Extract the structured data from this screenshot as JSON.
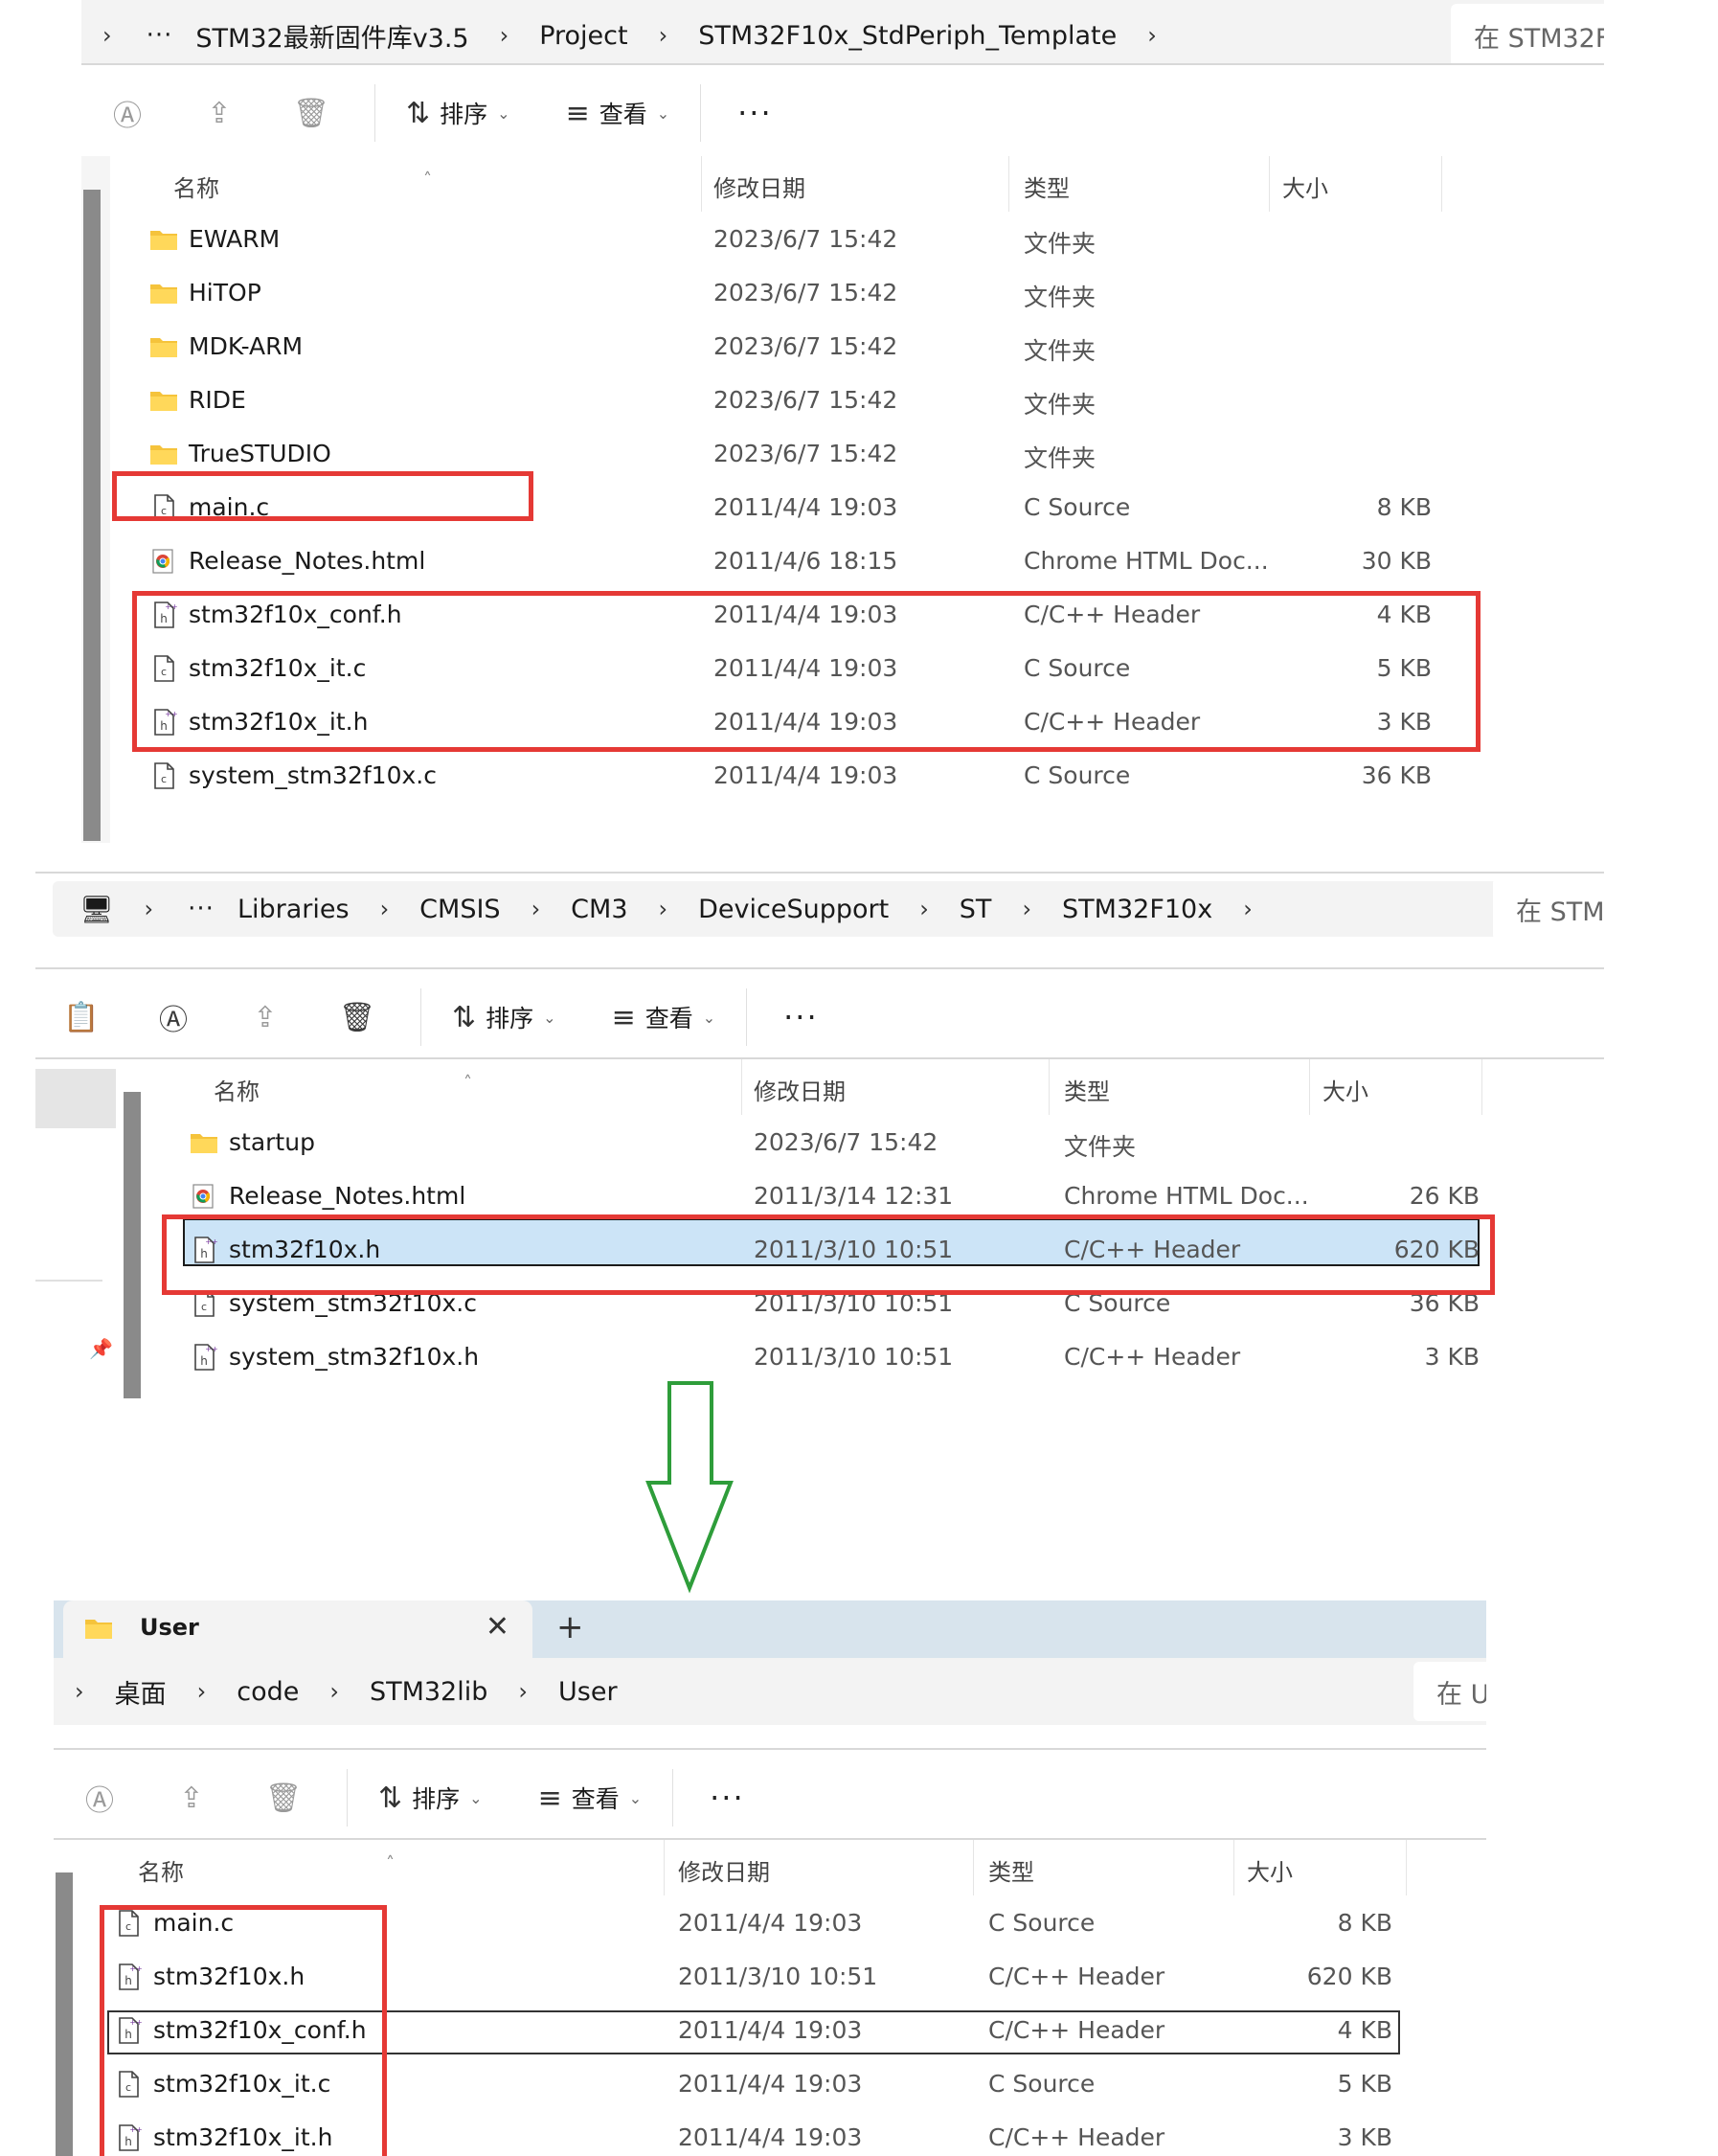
{
  "pane1": {
    "address": [
      "STM32最新固件库v3.5",
      "Project",
      "STM32F10x_StdPeriph_Template"
    ],
    "search": "在 STM32F",
    "toolbar": {
      "sort": "排序",
      "view": "查看"
    },
    "columns": {
      "name": "名称",
      "date": "修改日期",
      "type": "类型",
      "size": "大小"
    },
    "rows": [
      {
        "name": "EWARM",
        "date": "2023/6/7 15:42",
        "type": "文件夹",
        "size": "",
        "icon": "folder-icon"
      },
      {
        "name": "HiTOP",
        "date": "2023/6/7 15:42",
        "type": "文件夹",
        "size": "",
        "icon": "folder-icon"
      },
      {
        "name": "MDK-ARM",
        "date": "2023/6/7 15:42",
        "type": "文件夹",
        "size": "",
        "icon": "folder-icon"
      },
      {
        "name": "RIDE",
        "date": "2023/6/7 15:42",
        "type": "文件夹",
        "size": "",
        "icon": "folder-icon"
      },
      {
        "name": "TrueSTUDIO",
        "date": "2023/6/7 15:42",
        "type": "文件夹",
        "size": "",
        "icon": "folder-icon"
      },
      {
        "name": "main.c",
        "date": "2011/4/4 19:03",
        "type": "C Source",
        "size": "8 KB",
        "icon": "c-source-file-icon"
      },
      {
        "name": "Release_Notes.html",
        "date": "2011/4/6 18:15",
        "type": "Chrome HTML Doc...",
        "size": "30 KB",
        "icon": "chrome-html-icon"
      },
      {
        "name": "stm32f10x_conf.h",
        "date": "2011/4/4 19:03",
        "type": "C/C++ Header",
        "size": "4 KB",
        "icon": "header-file-icon"
      },
      {
        "name": "stm32f10x_it.c",
        "date": "2011/4/4 19:03",
        "type": "C Source",
        "size": "5 KB",
        "icon": "c-source-file-icon"
      },
      {
        "name": "stm32f10x_it.h",
        "date": "2011/4/4 19:03",
        "type": "C/C++ Header",
        "size": "3 KB",
        "icon": "header-file-icon"
      },
      {
        "name": "system_stm32f10x.c",
        "date": "2011/4/4 19:03",
        "type": "C Source",
        "size": "36 KB",
        "icon": "c-source-file-icon"
      }
    ]
  },
  "pane2": {
    "address": [
      "Libraries",
      "CMSIS",
      "CM3",
      "DeviceSupport",
      "ST",
      "STM32F10x"
    ],
    "search": "在 STM",
    "toolbar": {
      "sort": "排序",
      "view": "查看"
    },
    "columns": {
      "name": "名称",
      "date": "修改日期",
      "type": "类型",
      "size": "大小"
    },
    "rows": [
      {
        "name": "startup",
        "date": "2023/6/7 15:42",
        "type": "文件夹",
        "size": "",
        "icon": "folder-icon"
      },
      {
        "name": "Release_Notes.html",
        "date": "2011/3/14 12:31",
        "type": "Chrome HTML Doc...",
        "size": "26 KB",
        "icon": "chrome-html-icon"
      },
      {
        "name": "stm32f10x.h",
        "date": "2011/3/10 10:51",
        "type": "C/C++ Header",
        "size": "620 KB",
        "icon": "header-file-icon"
      },
      {
        "name": "system_stm32f10x.c",
        "date": "2011/3/10 10:51",
        "type": "C Source",
        "size": "36 KB",
        "icon": "c-source-file-icon"
      },
      {
        "name": "system_stm32f10x.h",
        "date": "2011/3/10 10:51",
        "type": "C/C++ Header",
        "size": "3 KB",
        "icon": "header-file-icon"
      }
    ]
  },
  "pane3": {
    "tab": "User",
    "address": [
      "桌面",
      "code",
      "STM32lib",
      "User"
    ],
    "search": "在 U",
    "toolbar": {
      "sort": "排序",
      "view": "查看"
    },
    "columns": {
      "name": "名称",
      "date": "修改日期",
      "type": "类型",
      "size": "大小"
    },
    "rows": [
      {
        "name": "main.c",
        "date": "2011/4/4 19:03",
        "type": "C Source",
        "size": "8 KB",
        "icon": "c-source-file-icon"
      },
      {
        "name": "stm32f10x.h",
        "date": "2011/3/10 10:51",
        "type": "C/C++ Header",
        "size": "620 KB",
        "icon": "header-file-icon"
      },
      {
        "name": "stm32f10x_conf.h",
        "date": "2011/4/4 19:03",
        "type": "C/C++ Header",
        "size": "4 KB",
        "icon": "header-file-icon"
      },
      {
        "name": "stm32f10x_it.c",
        "date": "2011/4/4 19:03",
        "type": "C Source",
        "size": "5 KB",
        "icon": "c-source-file-icon"
      },
      {
        "name": "stm32f10x_it.h",
        "date": "2011/4/4 19:03",
        "type": "C/C++ Header",
        "size": "3 KB",
        "icon": "header-file-icon"
      }
    ]
  },
  "colors": {
    "highlight": "#e53935",
    "arrow": "#2e9d3a",
    "selection": "#cce4f7",
    "folder": "#f5c33b"
  }
}
